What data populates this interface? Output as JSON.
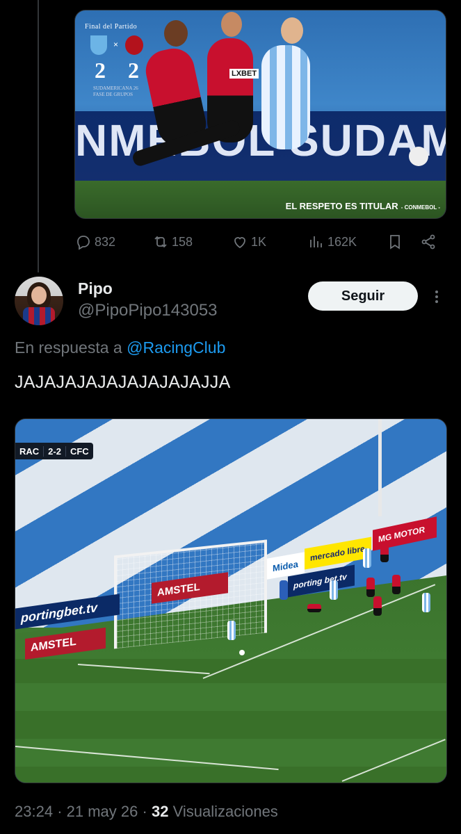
{
  "top_media": {
    "final_label": "Final del Partido",
    "home_score": "2",
    "away_score": "2",
    "sub_label_1": "SUDAMERICANA 26",
    "sub_label_2": "FASE DE GRUPOS",
    "ad_text": "NMEBOL SUDAME",
    "sponsor": "LXBET",
    "slogan": "EL RESPETO ES TITULAR",
    "slogan_brand": "- CONMEBOL -"
  },
  "actions": {
    "replies": "832",
    "reposts": "158",
    "likes": "1K",
    "views": "162K"
  },
  "reply": {
    "display_name": "Pipo",
    "handle": "@PipoPipo143053",
    "follow_label": "Seguir",
    "reply_prefix": "En respuesta a",
    "reply_mention": "@RacingClub",
    "text": "JAJAJAJAJAJAJAJAJAJJA"
  },
  "video": {
    "home": "RAC",
    "score": "2-2",
    "away": "CFC",
    "ads": {
      "sporting": "portingbet.tv",
      "amstel": "AMSTEL",
      "midea": "Midea",
      "mercado": "mercado libre",
      "mg": "MG MOTOR",
      "sporting2": "porting bet.tv"
    }
  },
  "footer": {
    "time": "23:24",
    "date": "21 may 26",
    "views_count": "32",
    "views_label": "Visualizaciones"
  },
  "icons": [
    "reply-icon",
    "repost-icon",
    "like-icon",
    "views-icon",
    "bookmark-icon",
    "share-icon",
    "more-icon"
  ]
}
